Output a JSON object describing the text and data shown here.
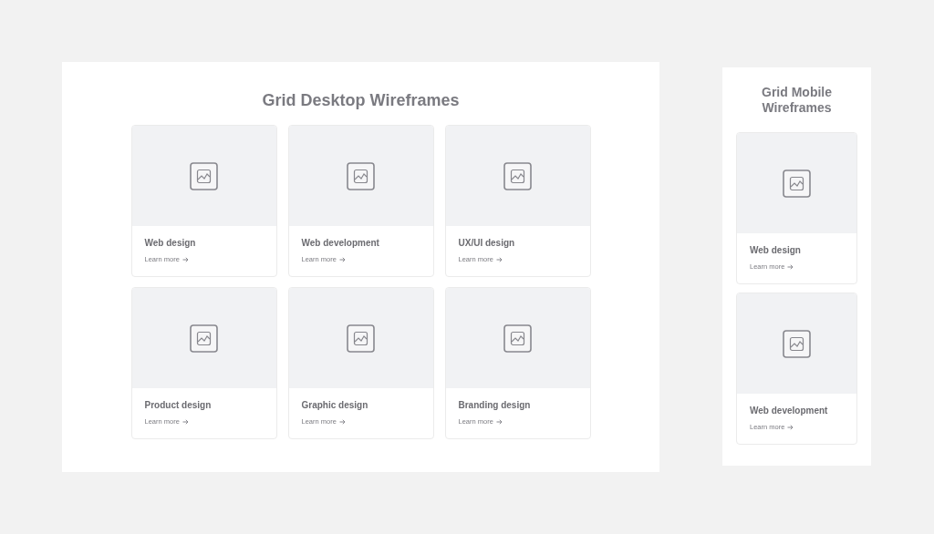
{
  "panels": [
    {
      "kind": "desktop",
      "title": "Grid Desktop Wireframes",
      "cards": [
        {
          "title": "Web design",
          "link": "Learn more"
        },
        {
          "title": "Web development",
          "link": "Learn more"
        },
        {
          "title": "UX/UI design",
          "link": "Learn more"
        },
        {
          "title": "Product design",
          "link": "Learn more"
        },
        {
          "title": "Graphic design",
          "link": "Learn more"
        },
        {
          "title": "Branding design",
          "link": "Learn more"
        }
      ]
    },
    {
      "kind": "mobile",
      "title": "Grid Mobile Wireframes",
      "cards": [
        {
          "title": "Web design",
          "link": "Learn more"
        },
        {
          "title": "Web development",
          "link": "Learn more"
        }
      ]
    }
  ]
}
